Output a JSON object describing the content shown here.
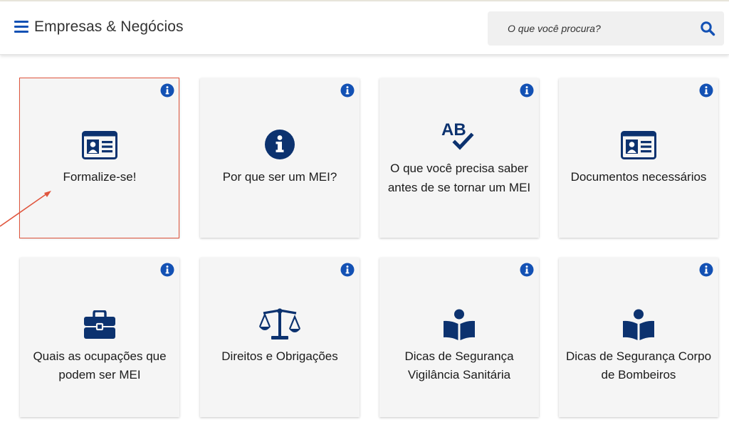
{
  "header": {
    "title": "Empresas & Negócios",
    "search_placeholder": "O que você procura?"
  },
  "colors": {
    "primary": "#1351b4",
    "icon_dark": "#0c326f",
    "card_bg": "#f5f5f5",
    "highlight": "#e0553d"
  },
  "cards": [
    {
      "label": "Formalize-se!",
      "icon": "id-card-icon"
    },
    {
      "label": "Por que ser um MEI?",
      "icon": "info-circle-icon"
    },
    {
      "label": "O que você precisa saber antes de se tornar um MEI",
      "icon": "ab-check-icon",
      "icon_text": "AB"
    },
    {
      "label": "Documentos necessários",
      "icon": "id-card-icon"
    },
    {
      "label": "Quais as ocupações que podem ser MEI",
      "icon": "briefcase-icon"
    },
    {
      "label": "Direitos e Obrigações",
      "icon": "balance-scale-icon"
    },
    {
      "label": "Dicas de Segurança Vigilância Sanitária",
      "icon": "book-reader-icon"
    },
    {
      "label": "Dicas de Segurança Corpo de Bombeiros",
      "icon": "book-reader-icon"
    }
  ]
}
